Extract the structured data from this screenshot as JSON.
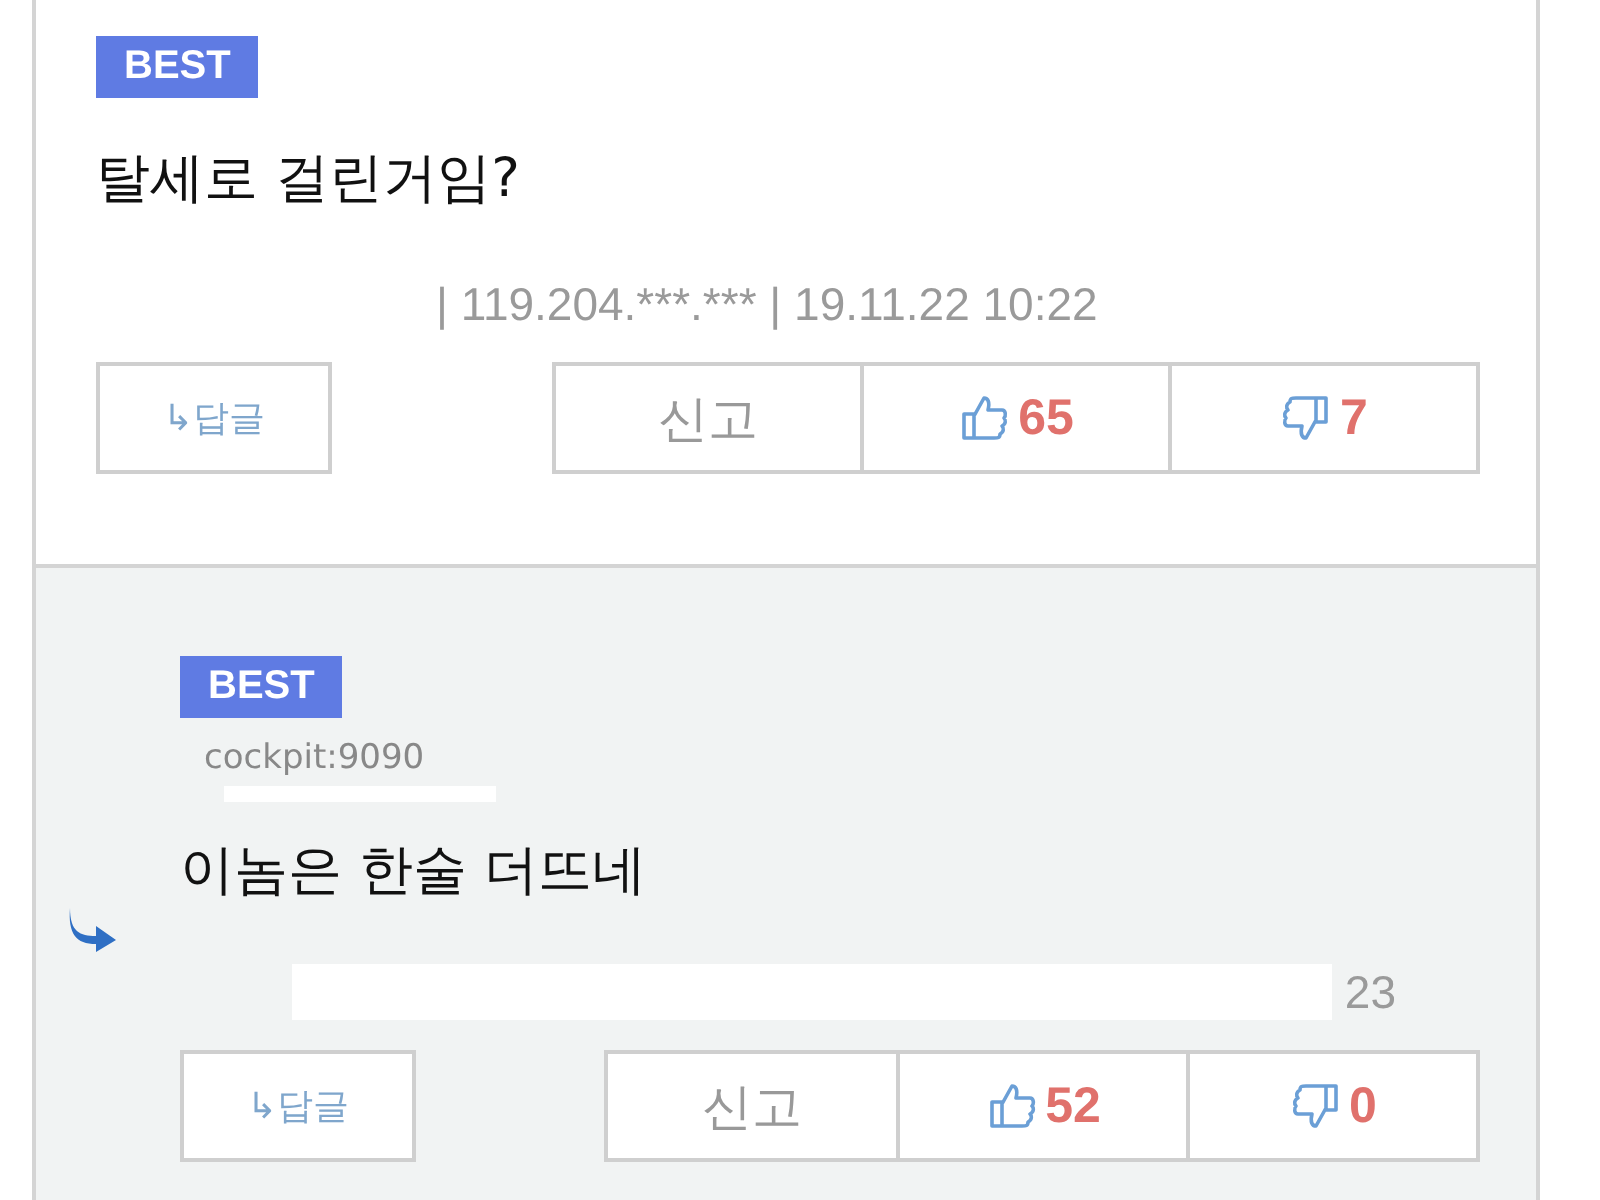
{
  "comments": [
    {
      "kind": "comment",
      "badge": "BEST",
      "text": "탈세로 걸린거임?",
      "meta": "| 119.204.***.*** | 19.11.22 10:22",
      "meta_redacted": false,
      "reply_button": "↳답글",
      "report_button": "신고",
      "likes": "65",
      "dislikes": "7"
    },
    {
      "kind": "reply",
      "badge": "BEST",
      "author": "cockpit:9090",
      "text": "이놈은 한술 더뜨네",
      "meta": "23",
      "meta_redacted": true,
      "reply_button": "↳답글",
      "report_button": "신고",
      "likes": "52",
      "dislikes": "0"
    }
  ]
}
